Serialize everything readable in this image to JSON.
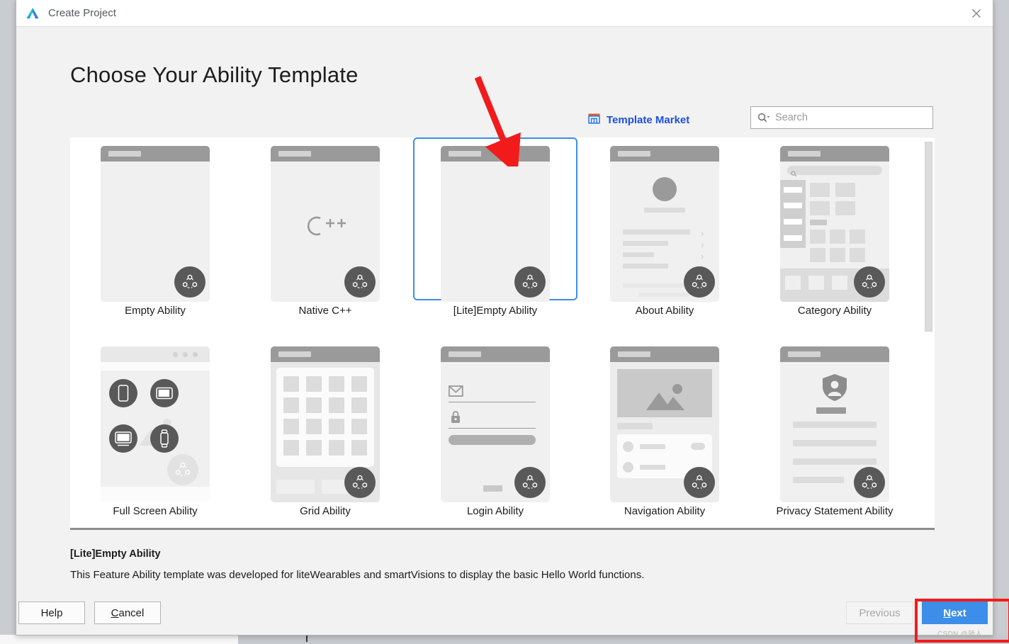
{
  "window": {
    "title": "Create Project",
    "logo_icon": "deveco-studio-logo",
    "close_icon": "close-icon"
  },
  "page": {
    "heading": "Choose Your Ability Template"
  },
  "toolbar": {
    "template_market_label": "Template Market",
    "template_market_icon": "store-icon",
    "template_market_color": "#1f4fe0",
    "search": {
      "icon": "search-icon",
      "value": "",
      "placeholder": "Search"
    }
  },
  "templates": {
    "selected": "[Lite]Empty Ability",
    "selection_color": "#3d8ee8",
    "rows": [
      [
        {
          "label": "Empty Ability",
          "kind": "empty",
          "selected": false
        },
        {
          "label": "Native C++",
          "kind": "native-cpp",
          "glyph": "C++",
          "selected": false
        },
        {
          "label": "[Lite]Empty Ability",
          "kind": "empty",
          "selected": true
        },
        {
          "label": "About Ability",
          "kind": "about",
          "selected": false
        },
        {
          "label": "Category Ability",
          "kind": "category",
          "selected": false
        }
      ],
      [
        {
          "label": "Full Screen Ability",
          "kind": "fullscreen",
          "selected": false
        },
        {
          "label": "Grid Ability",
          "kind": "grid",
          "selected": false
        },
        {
          "label": "Login Ability",
          "kind": "login",
          "selected": false
        },
        {
          "label": "Navigation Ability",
          "kind": "navigation",
          "selected": false
        },
        {
          "label": "Privacy Statement Ability",
          "kind": "privacy",
          "selected": false
        }
      ]
    ]
  },
  "description": {
    "title": "[Lite]Empty Ability",
    "body": "This Feature Ability template was developed for liteWearables and smartVisions to display the basic Hello World functions."
  },
  "footer": {
    "help_label": "Help",
    "cancel_label": "Cancel",
    "cancel_mnemonic": "C",
    "cancel_rest": "ancel",
    "previous_label": "Previous",
    "next_mnemonic": "N",
    "next_rest": "ext",
    "next_label": "Next",
    "next_color": "#3d8ee8"
  },
  "annotations": {
    "arrow_color": "#f21b1b",
    "box_color": "#f21b1b",
    "watermark": "CSDN @骄人"
  }
}
